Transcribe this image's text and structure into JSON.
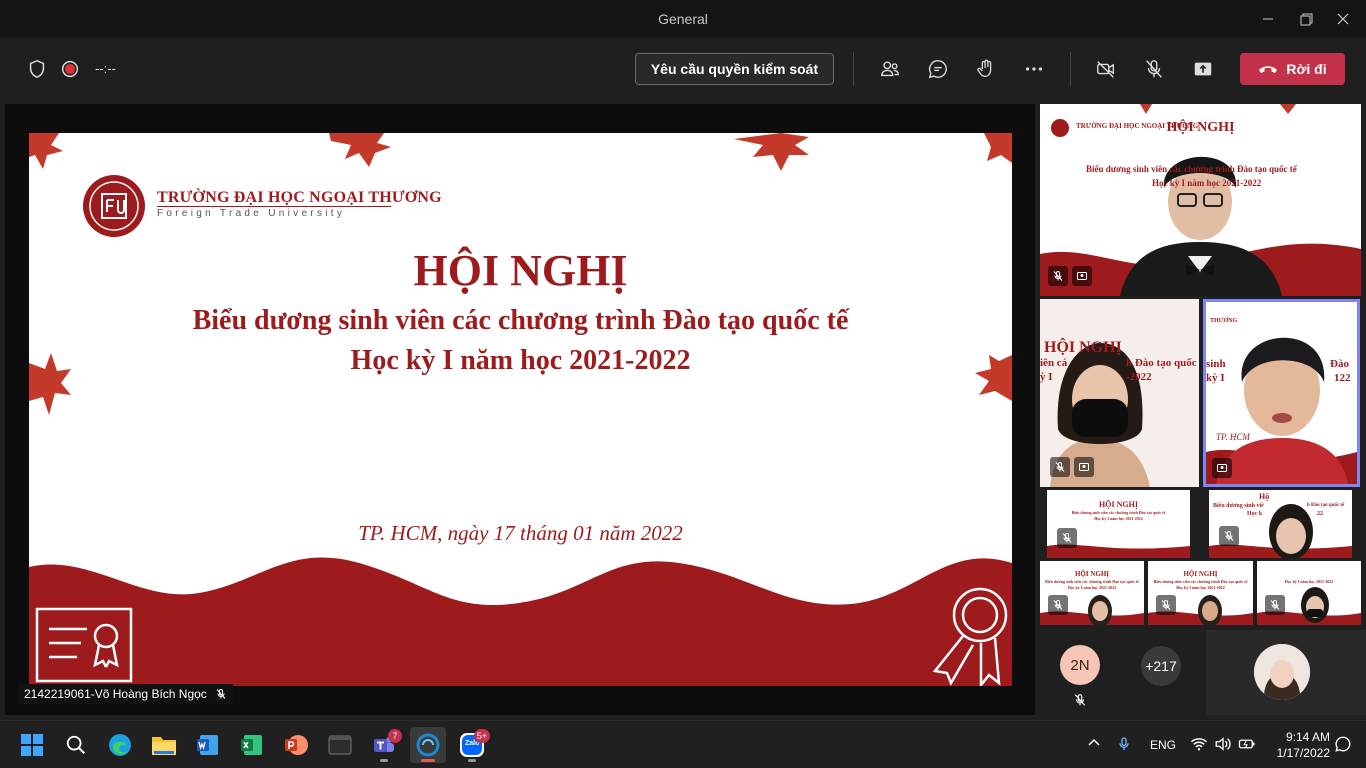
{
  "window": {
    "title": "General"
  },
  "toolbar": {
    "timer": "--:--",
    "request_control_label": "Yêu cầu quyền kiểm soát",
    "leave_label": "Rời đi"
  },
  "slide": {
    "logo_name": "TRƯỜNG ĐẠI HỌC NGOẠI THƯƠNG",
    "logo_sub": "Foreign Trade University",
    "title": "HỘI NGHỊ",
    "subtitle1": "Biểu dương sinh viên các chương trình Đào tạo quốc tế",
    "subtitle2": "Học kỳ I năm học 2021-2022",
    "date": "TP. HCM, ngày 17 tháng 01 năm 2022"
  },
  "presenter": {
    "name": "2142219061-Võ Hoàng Bích Ngọc"
  },
  "participants": {
    "overflow_initials": "2N",
    "more_count": "+217",
    "thumb_logo": "TRƯỜNG ĐẠI HỌC NGOẠI THƯƠNG",
    "thumb_title": "HỘI NGHỊ",
    "thumb_sub1": "Biểu dương sinh viên các chương trình Đào tạo quốc tế",
    "thumb_sub2": "Học kỳ I năm học 2021-2022",
    "thumb_sub3": "Học kỳ I năm học 2021-2022",
    "thumb_date": "TP. HCM, ngày 17 tháng 01 năm 2022",
    "tile3_title": "HỘI NGHỊ",
    "tile3_line1": "iên cá",
    "tile3_line2": "ỳ I",
    "tile3_line1b": "h Đào tạo quốc tế",
    "tile3_line2b": "-2022",
    "tile4_line1": "sinh",
    "tile4_line1b": "Đào",
    "tile4_line2": "kỳ I",
    "tile4_line2b": "122",
    "tile4_date": "TP. HCM",
    "tile4_logo": "THƯƠNG",
    "tile6_title": "Hộ",
    "tile6_line1": "Biểu dương sinh viê",
    "tile6_line1b": "h Đào tạo quốc tế",
    "tile6_line2": "Học k",
    "tile6_line2b": "22"
  },
  "taskbar": {
    "apps": [
      "windows-start",
      "search",
      "edge",
      "file-explorer",
      "word",
      "excel",
      "powerpoint",
      "terminal",
      "teams",
      "zalo-pc",
      "zalo"
    ],
    "teams_badge": "7",
    "zalo_badge": "5+",
    "zalo_label": "Zalo",
    "language": "ENG",
    "time": "9:14 AM",
    "date": "1/17/2022"
  },
  "colors": {
    "accent_red": "#9e1b1d",
    "leave_red": "#c4314b",
    "active_tile": "#7f85f5"
  }
}
